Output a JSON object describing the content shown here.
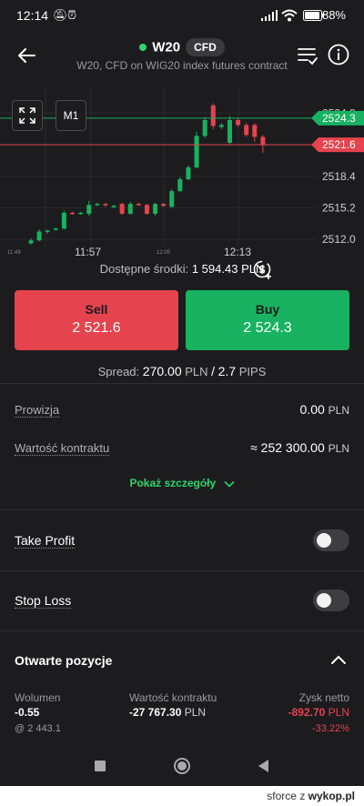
{
  "status_bar": {
    "time": "12:14",
    "battery_percent": "88%"
  },
  "header": {
    "title": "W20",
    "badge": "CFD",
    "subtitle": "W20, CFD on WIG20 index futures contract",
    "live_color": "#2bd66b"
  },
  "chart": {
    "timeframe_label": "M1",
    "price_labels": [
      "2524.8",
      "2518.4",
      "2515.2",
      "2512.0"
    ],
    "ask_label": "2524.3",
    "bid_label": "2521.6",
    "time_labels": [
      "11:57",
      "12:13"
    ],
    "time_labels_small": [
      "11:49",
      "12:05"
    ]
  },
  "chart_data": {
    "type": "candlestick",
    "y_range": [
      2511,
      2526.5
    ],
    "ask_line": 2524.3,
    "bid_line": 2521.6,
    "candles": [
      {
        "o": 2511.6,
        "c": 2511.9,
        "h": 2512.1,
        "l": 2511.5
      },
      {
        "o": 2511.9,
        "c": 2512.8,
        "h": 2513.0,
        "l": 2511.8
      },
      {
        "o": 2512.8,
        "c": 2512.9,
        "h": 2513.0,
        "l": 2512.6
      },
      {
        "o": 2513.0,
        "c": 2513.1,
        "h": 2513.2,
        "l": 2512.9
      },
      {
        "o": 2513.1,
        "c": 2514.7,
        "h": 2514.9,
        "l": 2513.0
      },
      {
        "o": 2514.7,
        "c": 2514.6,
        "h": 2514.8,
        "l": 2514.5
      },
      {
        "o": 2514.6,
        "c": 2514.7,
        "h": 2514.8,
        "l": 2514.5
      },
      {
        "o": 2514.6,
        "c": 2515.5,
        "h": 2515.9,
        "l": 2514.4
      },
      {
        "o": 2515.5,
        "c": 2515.6,
        "h": 2515.7,
        "l": 2515.4
      },
      {
        "o": 2515.6,
        "c": 2515.5,
        "h": 2515.7,
        "l": 2515.3
      },
      {
        "o": 2515.3,
        "c": 2515.4,
        "h": 2515.5,
        "l": 2515.2
      },
      {
        "o": 2515.6,
        "c": 2514.6,
        "h": 2515.7,
        "l": 2514.5
      },
      {
        "o": 2514.6,
        "c": 2515.6,
        "h": 2515.8,
        "l": 2514.5
      },
      {
        "o": 2515.6,
        "c": 2515.5,
        "h": 2515.7,
        "l": 2515.4
      },
      {
        "o": 2515.5,
        "c": 2514.6,
        "h": 2515.6,
        "l": 2514.5
      },
      {
        "o": 2514.6,
        "c": 2515.6,
        "h": 2515.7,
        "l": 2514.4
      },
      {
        "o": 2515.6,
        "c": 2515.4,
        "h": 2515.7,
        "l": 2515.3
      },
      {
        "o": 2515.3,
        "c": 2516.9,
        "h": 2517.1,
        "l": 2515.2
      },
      {
        "o": 2516.9,
        "c": 2518.1,
        "h": 2518.3,
        "l": 2516.8
      },
      {
        "o": 2518.1,
        "c": 2519.3,
        "h": 2519.5,
        "l": 2518.0
      },
      {
        "o": 2519.3,
        "c": 2522.5,
        "h": 2522.9,
        "l": 2519.2
      },
      {
        "o": 2522.5,
        "c": 2524.1,
        "h": 2524.4,
        "l": 2522.3
      },
      {
        "o": 2525.6,
        "c": 2523.5,
        "h": 2525.8,
        "l": 2523.2
      },
      {
        "o": 2523.4,
        "c": 2523.6,
        "h": 2523.8,
        "l": 2523.2
      },
      {
        "o": 2521.8,
        "c": 2524.1,
        "h": 2524.5,
        "l": 2521.6
      },
      {
        "o": 2524.1,
        "c": 2523.6,
        "h": 2524.3,
        "l": 2523.4
      },
      {
        "o": 2523.6,
        "c": 2522.6,
        "h": 2523.8,
        "l": 2522.4
      },
      {
        "o": 2523.6,
        "c": 2522.4,
        "h": 2523.8,
        "l": 2521.9
      },
      {
        "o": 2522.4,
        "c": 2521.6,
        "h": 2522.6,
        "l": 2520.8
      }
    ],
    "up_color": "#18b260",
    "down_color": "#e5434e"
  },
  "funds": {
    "label": "Dostępne środki:",
    "value": "1 594.43",
    "unit": "PLN"
  },
  "sell": {
    "label": "Sell",
    "price": "2 521.6",
    "color": "#e5434e"
  },
  "buy": {
    "label": "Buy",
    "price": "2 524.3",
    "color": "#18b260"
  },
  "spread": {
    "label": "Spread:",
    "value": "270.00",
    "unit": "PLN",
    "sep": "/",
    "pips": "2.7",
    "pips_unit": "PIPS"
  },
  "details": {
    "commission": {
      "label": "Prowizja",
      "value": "0.00",
      "unit": "PLN"
    },
    "contract_value": {
      "label": "Wartość kontraktu",
      "value": "≈ 252 300.00",
      "unit": "PLN"
    },
    "show_more": "Pokaż szczegóły"
  },
  "take_profit": {
    "label": "Take Profit",
    "enabled": false
  },
  "stop_loss": {
    "label": "Stop Loss",
    "enabled": false
  },
  "open_positions": {
    "title": "Otwarte pozycje",
    "volume_label": "Wolumen",
    "volume_value": "-0.55",
    "open_price": "@ 2 443.1",
    "contract_label": "Wartość kontraktu",
    "contract_value": "-27 767.30",
    "contract_unit": "PLN",
    "profit_label": "Zysk netto",
    "profit_value": "-892.70",
    "profit_unit": "PLN",
    "profit_percent": "-33.22%",
    "loss_color": "#e5434e"
  },
  "watermark": {
    "user": "sforce",
    "sep": "z",
    "brand": "wykop.pl"
  }
}
